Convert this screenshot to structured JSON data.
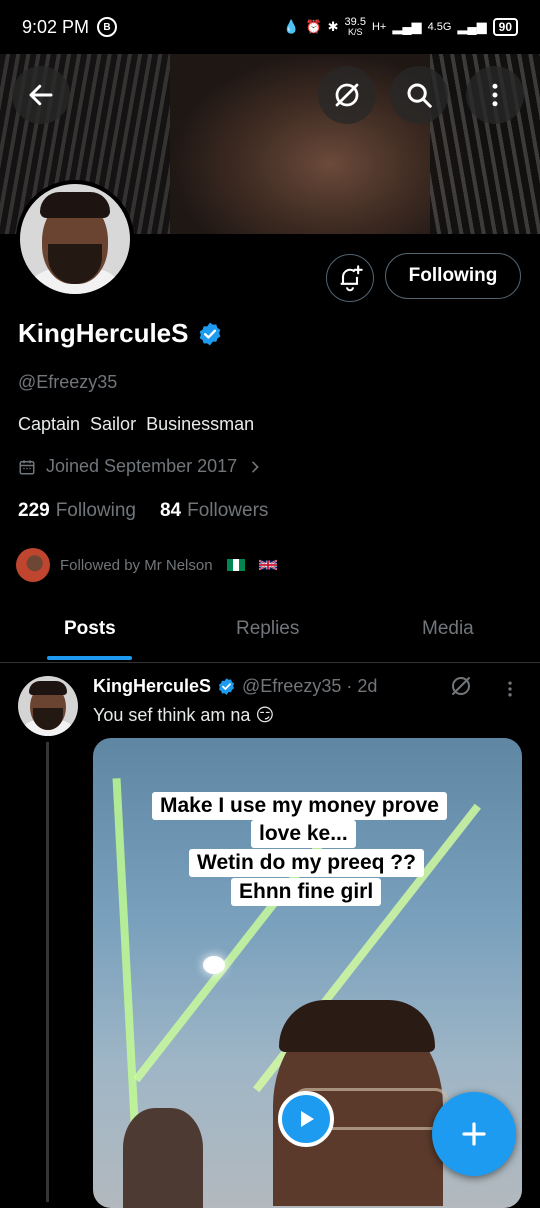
{
  "status_bar": {
    "time": "9:02 PM",
    "net_speed": "39.5",
    "net_unit": "K/S",
    "network_1": "H+",
    "network_2": "4.5G",
    "battery": "90"
  },
  "profile": {
    "name": "KingHerculeS",
    "handle": "@Efreezy35",
    "bio": "Captain  Sailor  Businessman",
    "joined": "Joined September 2017",
    "following_count": "229",
    "following_label": "Following",
    "followers_count": "84",
    "followers_label": "Followers",
    "followed_by": "Followed by Mr Nelson",
    "follow_button": "Following"
  },
  "tabs": [
    {
      "label": "Posts",
      "active": true
    },
    {
      "label": "Replies",
      "active": false
    },
    {
      "label": "Media",
      "active": false
    }
  ],
  "post": {
    "name": "KingHerculeS",
    "meta": "@Efreezy35 · 2d",
    "text": "You sef think am na 😏",
    "captions": [
      "Make I use my money prove",
      "love ke...",
      "Wetin do my preeq ??",
      "Ehnn fine girl"
    ]
  },
  "colors": {
    "accent": "#1d9bf0",
    "background": "#000000",
    "muted_text": "#71767b",
    "primary_text": "#e7e9ea"
  },
  "icons": [
    "back-arrow-icon",
    "grok-icon",
    "search-icon",
    "more-vertical-icon",
    "bell-plus-icon",
    "verified-badge-icon",
    "calendar-icon",
    "chevron-right-icon",
    "play-icon",
    "plus-icon"
  ]
}
